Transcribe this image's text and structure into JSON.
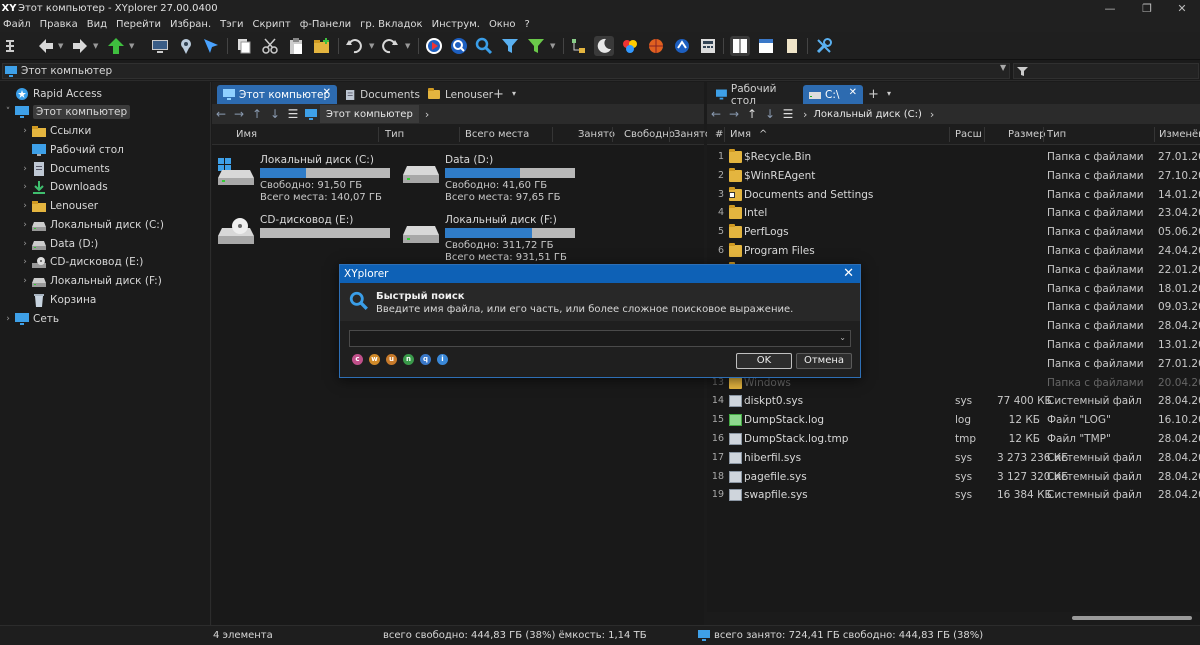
{
  "window": {
    "title": "Этот компьютер - XYplorer 27.00.0400",
    "logo": "XY",
    "minimize": "—",
    "restore": "❐",
    "close": "✕"
  },
  "menu": [
    "Файл",
    "Правка",
    "Вид",
    "Перейти",
    "Избран.",
    "Тэги",
    "Скрипт",
    "ф-Панели",
    "гр. Вкладок",
    "Инструм.",
    "Окно",
    "?"
  ],
  "address": {
    "value": "Этот компьютер",
    "filter_value": ""
  },
  "tree": {
    "items": [
      {
        "label": "Rapid Access",
        "icon": "star-icon",
        "level": 0,
        "expander": ""
      },
      {
        "label": "Этот компьютер",
        "icon": "computer-icon",
        "level": 0,
        "expander": "˅",
        "selected": true
      },
      {
        "label": "Ссылки",
        "icon": "folder-icon",
        "level": 1,
        "expander": "›"
      },
      {
        "label": "Рабочий стол",
        "icon": "desktop-icon",
        "level": 1,
        "expander": ""
      },
      {
        "label": "Documents",
        "icon": "documents-icon",
        "level": 1,
        "expander": "›"
      },
      {
        "label": "Downloads",
        "icon": "download-icon",
        "level": 1,
        "expander": "›"
      },
      {
        "label": "Lenouser",
        "icon": "folder-icon",
        "level": 1,
        "expander": "›"
      },
      {
        "label": "Локальный диск (C:)",
        "icon": "drive-icon",
        "level": 1,
        "expander": "›"
      },
      {
        "label": "Data (D:)",
        "icon": "drive-icon",
        "level": 1,
        "expander": "›"
      },
      {
        "label": "CD-дисковод (E:)",
        "icon": "cd-drive-icon",
        "level": 1,
        "expander": "›"
      },
      {
        "label": "Локальный диск (F:)",
        "icon": "drive-icon",
        "level": 1,
        "expander": "›"
      },
      {
        "label": "Корзина",
        "icon": "recycle-bin-icon",
        "level": 1,
        "expander": ""
      },
      {
        "label": "Сеть",
        "icon": "network-icon",
        "level": 0,
        "expander": "›"
      }
    ]
  },
  "pane1": {
    "tabs": [
      {
        "label": "Этот компьютер",
        "active": true,
        "close": "✕"
      },
      {
        "label": "Documents"
      },
      {
        "label": "Lenouser"
      }
    ],
    "tab_plus": "+",
    "tab_dd": "▾",
    "path": "Этот компьютер",
    "path_arrow": "›",
    "columns": [
      "Имя",
      "Тип",
      "Всего места",
      "Занято",
      "Свободно",
      "Занято"
    ],
    "drives": [
      {
        "name": "Локальный диск (C:)",
        "used_fraction": 0.35,
        "free": "Свободно: 91,50 ГБ",
        "total": "Всего места: 140,07 ГБ",
        "icon": "windows-drive-icon"
      },
      {
        "name": "Data (D:)",
        "used_fraction": 0.58,
        "free": "Свободно: 41,60 ГБ",
        "total": "Всего места: 97,65 ГБ",
        "icon": "drive-icon"
      },
      {
        "name": "CD-дисковод (E:)",
        "used_fraction": 0,
        "free": "",
        "total": "",
        "icon": "cd-drive-icon"
      },
      {
        "name": "Локальный диск (F:)",
        "used_fraction": 0.67,
        "free": "Свободно: 311,72 ГБ",
        "total": "Всего места: 931,51 ГБ",
        "icon": "drive-icon"
      }
    ]
  },
  "pane2": {
    "tabs": [
      {
        "label": "Рабочий стол"
      },
      {
        "label": "C:\\",
        "active": true,
        "close": "✕"
      }
    ],
    "tab_plus": "+",
    "tab_dd": "▾",
    "path": "Локальный диск (C:)",
    "path_arrow": "›",
    "columns": [
      "#",
      "Имя",
      "Расш",
      "Размер",
      "Тип",
      "Изменён"
    ],
    "rows": [
      {
        "n": "1",
        "name": "$Recycle.Bin",
        "ext": "",
        "size": "",
        "type": "Папка с файлами",
        "date": "27.01.2023",
        "kind": "folder"
      },
      {
        "n": "2",
        "name": "$WinREAgent",
        "ext": "",
        "size": "",
        "type": "Папка с файлами",
        "date": "27.10.2023",
        "kind": "folder"
      },
      {
        "n": "3",
        "name": "Documents and Settings",
        "ext": "",
        "size": "",
        "type": "Папка с файлами",
        "date": "14.01.2022",
        "kind": "link"
      },
      {
        "n": "4",
        "name": "Intel",
        "ext": "",
        "size": "",
        "type": "Папка с файлами",
        "date": "23.04.2025",
        "kind": "folder"
      },
      {
        "n": "5",
        "name": "PerfLogs",
        "ext": "",
        "size": "",
        "type": "Папка с файлами",
        "date": "05.06.2021",
        "kind": "folder"
      },
      {
        "n": "6",
        "name": "Program Files",
        "ext": "",
        "size": "",
        "type": "Папка с файлами",
        "date": "24.04.2025",
        "kind": "folder"
      },
      {
        "n": "7",
        "name": "",
        "ext": "",
        "size": "",
        "type": "Папка с файлами",
        "date": "22.01.2025",
        "kind": "hidden"
      },
      {
        "n": "8",
        "name": "",
        "ext": "",
        "size": "",
        "type": "Папка с файлами",
        "date": "18.01.2025",
        "kind": "hidden"
      },
      {
        "n": "9",
        "name": "",
        "ext": "",
        "size": "",
        "type": "Папка с файлами",
        "date": "09.03.2022",
        "kind": "hidden"
      },
      {
        "n": "10",
        "name": "",
        "ext": "",
        "size": "",
        "type": "Папка с файлами",
        "date": "28.04.2025",
        "kind": "hidden"
      },
      {
        "n": "11",
        "name": "",
        "ext": "",
        "size": "",
        "type": "Папка с файлами",
        "date": "13.01.2022",
        "kind": "hidden"
      },
      {
        "n": "12",
        "name": "",
        "ext": "",
        "size": "",
        "type": "Папка с файлами",
        "date": "27.01.2022",
        "kind": "hidden"
      },
      {
        "n": "13",
        "name": "Windows",
        "ext": "",
        "size": "",
        "type": "Папка с файлами",
        "date": "20.04.2025",
        "kind": "dim"
      },
      {
        "n": "14",
        "name": "diskpt0.sys",
        "ext": "sys",
        "size": "77 400 КБ",
        "type": "Системный файл",
        "date": "28.04.2025",
        "kind": "sys"
      },
      {
        "n": "15",
        "name": "DumpStack.log",
        "ext": "log",
        "size": "12 КБ",
        "type": "Файл \"LOG\"",
        "date": "16.10.2024",
        "kind": "log"
      },
      {
        "n": "16",
        "name": "DumpStack.log.tmp",
        "ext": "tmp",
        "size": "12 КБ",
        "type": "Файл \"TMP\"",
        "date": "28.04.2025",
        "kind": "sys"
      },
      {
        "n": "17",
        "name": "hiberfil.sys",
        "ext": "sys",
        "size": "3 273 236 КБ",
        "type": "Системный файл",
        "date": "28.04.2025",
        "kind": "sys"
      },
      {
        "n": "18",
        "name": "pagefile.sys",
        "ext": "sys",
        "size": "3 127 320 КБ",
        "type": "Системный файл",
        "date": "28.04.2025",
        "kind": "sys"
      },
      {
        "n": "19",
        "name": "swapfile.sys",
        "ext": "sys",
        "size": "16 384 КБ",
        "type": "Системный файл",
        "date": "28.04.2025",
        "kind": "sys"
      }
    ]
  },
  "dialog": {
    "title": "XYplorer",
    "close": "✕",
    "heading": "Быстрый поиск",
    "description": "Введите имя файла, или его часть, или более сложное поисковое выражение.",
    "input_value": "",
    "dropdown": "⌄",
    "chips": [
      {
        "t": "c",
        "color": "#c0508a"
      },
      {
        "t": "w",
        "color": "#d08a2a"
      },
      {
        "t": "u",
        "color": "#c87a2a"
      },
      {
        "t": "n",
        "color": "#3a9a4a"
      },
      {
        "t": "q",
        "color": "#3a78c8"
      },
      {
        "t": "i",
        "color": "#3a88d8"
      }
    ],
    "ok": "OK",
    "cancel": "Отмена"
  },
  "status": {
    "count": "4 элемента",
    "left_total": "всего  свободно: 444,83 ГБ (38%)  ёмкость: 1,14 ТБ",
    "right_total": "всего  занято: 724,41 ГБ  свободно: 444,83 ГБ (38%)"
  },
  "colors": {
    "accent": "#2d6bb0",
    "dialog_title": "#0e61b6",
    "folder": "#e4b53f",
    "bar_fill": "#2f7cc8"
  }
}
